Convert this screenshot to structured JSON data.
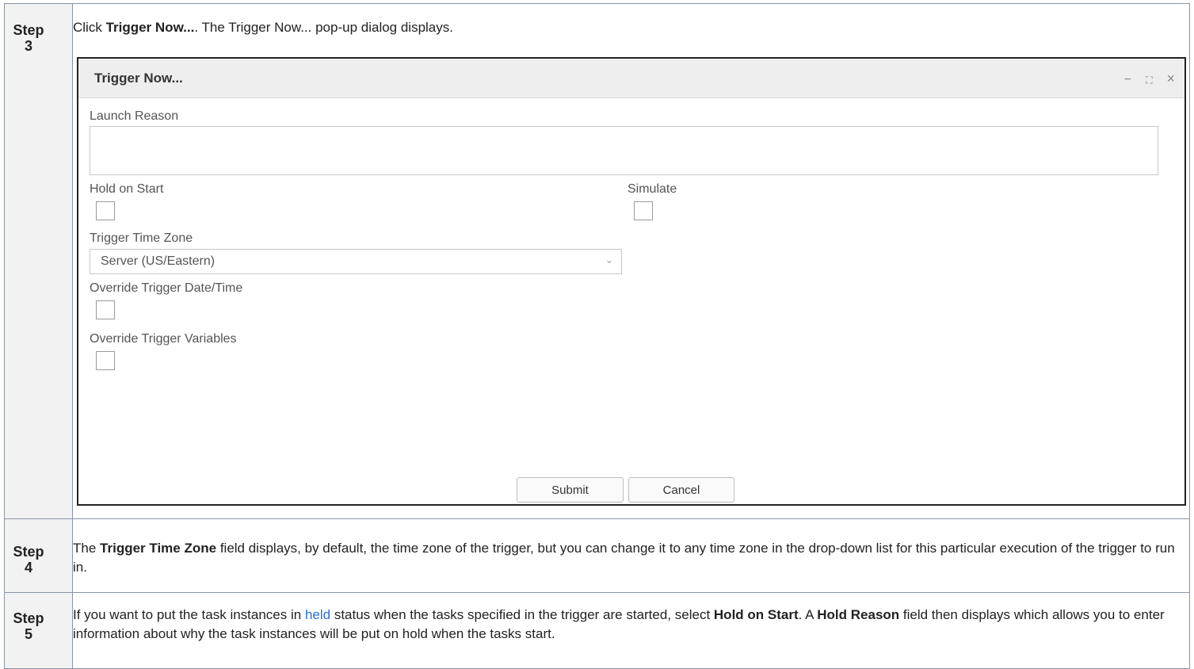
{
  "steps": [
    {
      "step_word": "Step",
      "step_num": "3"
    },
    {
      "step_word": "Step",
      "step_num": "4"
    },
    {
      "step_word": "Step",
      "step_num": "5"
    }
  ],
  "step3": {
    "pre": "Click ",
    "bold": "Trigger Now...",
    "post": ". The Trigger Now... pop-up dialog displays."
  },
  "dialog": {
    "title": "Trigger Now...",
    "minimize_glyph": "−",
    "maximize_glyph": "⛶",
    "close_glyph": "×",
    "launch_reason_label": "Launch Reason",
    "launch_reason_value": "",
    "hold_on_start_label": "Hold on Start",
    "hold_on_start_checked": false,
    "simulate_label": "Simulate",
    "simulate_checked": false,
    "time_zone_label": "Trigger Time Zone",
    "time_zone_value": "Server (US/Eastern)",
    "override_datetime_label": "Override Trigger Date/Time",
    "override_datetime_checked": false,
    "override_vars_label": "Override Trigger Variables",
    "override_vars_checked": false,
    "submit_label": "Submit",
    "cancel_label": "Cancel"
  },
  "step4": {
    "pre": "The ",
    "bold": "Trigger Time Zone",
    "post": " field displays, by default, the time zone of the trigger, but you can change it to any time zone in the drop-down list for this particular execution of the trigger to run in."
  },
  "step5": {
    "t1": "If you want to put the task instances in ",
    "link": "held",
    "t2": " status when the tasks specified in the trigger are started, select ",
    "b1": "Hold on Start",
    "t3": ". A ",
    "b2": "Hold Reason",
    "t4": " field then displays which allows you to enter information about why the task instances will be put on hold when the tasks start."
  },
  "colors": {
    "link": "#2a6ed6",
    "border": "#8a93a6",
    "step_bg": "#f2f2f2"
  }
}
